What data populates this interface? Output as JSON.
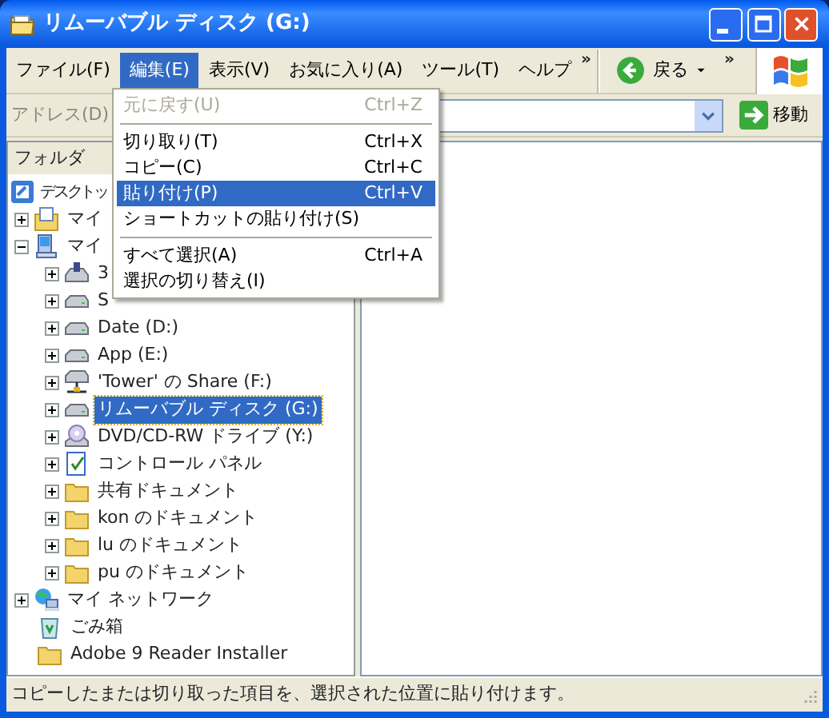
{
  "window": {
    "title": "リムーバブル ディスク (G:)"
  },
  "menu_bar": [
    {
      "label": "ファイル(F)",
      "selected": false
    },
    {
      "label": "編集(E)",
      "selected": true
    },
    {
      "label": "表示(V)",
      "selected": false
    },
    {
      "label": "お気に入り(A)",
      "selected": false
    },
    {
      "label": "ツール(T)",
      "selected": false
    },
    {
      "label": "ヘルプ",
      "selected": false
    }
  ],
  "menu_chevron": "»",
  "toolbar": {
    "back_label": "戻る",
    "chevron": "»"
  },
  "address_bar": {
    "label": "アドレス(D)",
    "go_label": "移動"
  },
  "folder_pane": {
    "title": "フォルダ"
  },
  "tree": [
    {
      "label": "デスクトッ",
      "kind": "desktop",
      "children": [
        {
          "label": "マイ",
          "kind": "documents",
          "expanded": false
        },
        {
          "label": "マイ",
          "kind": "computer",
          "expanded": true,
          "children": [
            {
              "label": "3",
              "kind": "floppy",
              "expanded": false
            },
            {
              "label": "S",
              "kind": "drive",
              "expanded": false
            },
            {
              "label": "Date (D:)",
              "kind": "drive",
              "expanded": false
            },
            {
              "label": "App (E:)",
              "kind": "drive",
              "expanded": false
            },
            {
              "label": "'Tower' の Share (F:)",
              "kind": "netdrive",
              "expanded": false
            },
            {
              "label": "リムーバブル ディスク (G:)",
              "kind": "drive",
              "expanded": false,
              "selected": true
            },
            {
              "label": "DVD/CD-RW ドライブ (Y:)",
              "kind": "cd",
              "expanded": false
            },
            {
              "label": "コントロール パネル",
              "kind": "control",
              "expanded": false
            },
            {
              "label": "共有ドキュメント",
              "kind": "folder",
              "expanded": false
            },
            {
              "label": "kon のドキュメント",
              "kind": "folder",
              "expanded": false
            },
            {
              "label": "lu のドキュメント",
              "kind": "folder",
              "expanded": false
            },
            {
              "label": "pu のドキュメント",
              "kind": "folder",
              "expanded": false
            }
          ]
        },
        {
          "label": "マイ ネットワーク",
          "kind": "network",
          "expanded": false
        },
        {
          "label": "ごみ箱",
          "kind": "trash"
        },
        {
          "label": "Adobe 9 Reader Installer",
          "kind": "folder"
        }
      ]
    }
  ],
  "edit_menu": [
    {
      "kind": "item",
      "label": "元に戻す(U)",
      "shortcut": "Ctrl+Z",
      "disabled": true,
      "selected": false
    },
    {
      "kind": "separator"
    },
    {
      "kind": "item",
      "label": "切り取り(T)",
      "shortcut": "Ctrl+X",
      "disabled": false,
      "selected": false
    },
    {
      "kind": "item",
      "label": "コピー(C)",
      "shortcut": "Ctrl+C",
      "disabled": false,
      "selected": false
    },
    {
      "kind": "item",
      "label": "貼り付け(P)",
      "shortcut": "Ctrl+V",
      "disabled": false,
      "selected": true
    },
    {
      "kind": "item",
      "label": "ショートカットの貼り付け(S)",
      "disabled": false,
      "selected": false
    },
    {
      "kind": "separator"
    },
    {
      "kind": "item",
      "label": "すべて選択(A)",
      "shortcut": "Ctrl+A",
      "disabled": false,
      "selected": false
    },
    {
      "kind": "item",
      "label": "選択の切り替え(I)",
      "disabled": false,
      "selected": false
    }
  ],
  "status_bar": "コピーしたまたは切り取った項目を、選択された位置に貼り付けます。"
}
